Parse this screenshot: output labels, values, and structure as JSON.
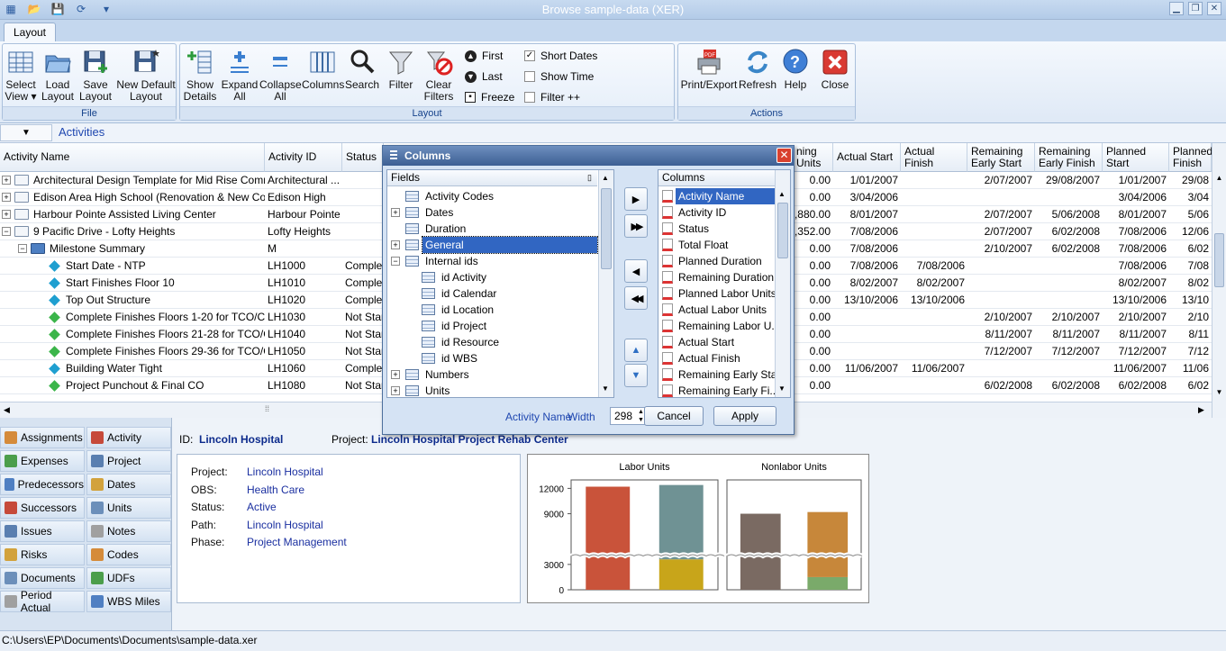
{
  "window": {
    "title": "Browse sample-data (XER)",
    "minimize_label": "▁",
    "restore_label": "❐",
    "close_label": "✕"
  },
  "quick_access": [
    "open-icon",
    "save-icon",
    "refresh-icon",
    "menu-icon"
  ],
  "ribbon": {
    "tab": "Layout",
    "file_group": {
      "label": "File",
      "buttons": [
        {
          "line1": "Select",
          "line2": "View ▾"
        },
        {
          "line1": "Load",
          "line2": "Layout"
        },
        {
          "line1": "Save",
          "line2": "Layout"
        },
        {
          "line1": "New Default",
          "line2": "Layout"
        }
      ]
    },
    "layout_group": {
      "label": "Layout",
      "buttons": [
        {
          "line1": "Show",
          "line2": "Details"
        },
        {
          "line1": "Expand",
          "line2": "All"
        },
        {
          "line1": "Collapse",
          "line2": "All"
        },
        {
          "line1": "Columns",
          "line2": ""
        },
        {
          "line1": "Search",
          "line2": ""
        },
        {
          "line1": "Filter",
          "line2": ""
        },
        {
          "line1": "Clear",
          "line2": "Filters"
        }
      ],
      "nav": {
        "first": "First",
        "last": "Last",
        "freeze": "Freeze"
      },
      "options": {
        "short_dates": "Short Dates",
        "show_time": "Show Time",
        "filter_pp": "Filter ++"
      }
    },
    "actions_group": {
      "label": "Actions",
      "buttons": [
        {
          "line1": "Print/Export",
          "line2": ""
        },
        {
          "line1": "Refresh",
          "line2": ""
        },
        {
          "line1": "Help",
          "line2": ""
        },
        {
          "line1": "Close",
          "line2": ""
        }
      ]
    }
  },
  "view": {
    "name": "Activities"
  },
  "grid": {
    "headers": {
      "activity_name": "Activity Name",
      "activity_id": "Activity ID",
      "status": "Status",
      "nlabor": "ning\nUnits",
      "actual_start": "Actual Start",
      "actual_finish": "Actual Finish",
      "rem_early_start": "Remaining\nEarly Start",
      "rem_early_finish": "Remaining\nEarly Finish",
      "planned_start": "Planned Start",
      "planned_finish": "Planned\nFinish"
    },
    "rows": [
      {
        "name": "Architectural Design Template for Mid Rise Comme...",
        "id": "Architectural ...",
        "status": "",
        "units": "0.00",
        "as": "1/01/2007",
        "af": "",
        "res": "2/07/2007",
        "ref": "29/08/2007",
        "ps": "1/01/2007",
        "pf": "29/08"
      },
      {
        "name": "Edison Area High School (Renovation & New Cons...",
        "id": "Edison High",
        "status": "",
        "units": "0.00",
        "as": "3/04/2006",
        "af": "",
        "res": "",
        "ref": "",
        "ps": "3/04/2006",
        "pf": "3/04"
      },
      {
        "name": "Harbour Pointe Assisted Living Center",
        "id": "Harbour Pointe",
        "status": "",
        "units": "1,880.00",
        "as": "8/01/2007",
        "af": "",
        "res": "2/07/2007",
        "ref": "5/06/2008",
        "ps": "8/01/2007",
        "pf": "5/06"
      },
      {
        "name": "9 Pacific Drive - Lofty Heights",
        "id": "Lofty Heights",
        "status": "",
        "units": "1,352.00",
        "as": "7/08/2006",
        "af": "",
        "res": "2/07/2007",
        "ref": "6/02/2008",
        "ps": "7/08/2006",
        "pf": "12/06"
      },
      {
        "name": "Milestone Summary",
        "id": "M",
        "status": "",
        "units": "0.00",
        "as": "7/08/2006",
        "af": "",
        "res": "2/10/2007",
        "ref": "6/02/2008",
        "ps": "7/08/2006",
        "pf": "6/02"
      },
      {
        "name": "Start Date - NTP",
        "id": "LH1000",
        "status": "Complet",
        "units": "0.00",
        "as": "7/08/2006",
        "af": "7/08/2006",
        "res": "",
        "ref": "",
        "ps": "7/08/2006",
        "pf": "7/08"
      },
      {
        "name": "Start Finishes Floor 10",
        "id": "LH1010",
        "status": "Complet",
        "units": "0.00",
        "as": "8/02/2007",
        "af": "8/02/2007",
        "res": "",
        "ref": "",
        "ps": "8/02/2007",
        "pf": "8/02"
      },
      {
        "name": "Top Out Structure",
        "id": "LH1020",
        "status": "Complet",
        "units": "0.00",
        "as": "13/10/2006",
        "af": "13/10/2006",
        "res": "",
        "ref": "",
        "ps": "13/10/2006",
        "pf": "13/10"
      },
      {
        "name": "Complete Finishes Floors 1-20 for TCO/Clo...",
        "id": "LH1030",
        "status": "Not Star",
        "units": "0.00",
        "as": "",
        "af": "",
        "res": "2/10/2007",
        "ref": "2/10/2007",
        "ps": "2/10/2007",
        "pf": "2/10"
      },
      {
        "name": "Complete Finishes Floors 21-28 for TCO/Cl...",
        "id": "LH1040",
        "status": "Not Star",
        "units": "0.00",
        "as": "",
        "af": "",
        "res": "8/11/2007",
        "ref": "8/11/2007",
        "ps": "8/11/2007",
        "pf": "8/11"
      },
      {
        "name": "Complete Finishes Floors 29-36 for TCO/Cl...",
        "id": "LH1050",
        "status": "Not Star",
        "units": "0.00",
        "as": "",
        "af": "",
        "res": "7/12/2007",
        "ref": "7/12/2007",
        "ps": "7/12/2007",
        "pf": "7/12"
      },
      {
        "name": "Building Water Tight",
        "id": "LH1060",
        "status": "Complet",
        "units": "0.00",
        "as": "11/06/2007",
        "af": "11/06/2007",
        "res": "",
        "ref": "",
        "ps": "11/06/2007",
        "pf": "11/06"
      },
      {
        "name": "Project Punchout & Final CO",
        "id": "LH1080",
        "status": "Not Star",
        "units": "0.00",
        "as": "",
        "af": "",
        "res": "6/02/2008",
        "ref": "6/02/2008",
        "ps": "6/02/2008",
        "pf": "6/02"
      }
    ]
  },
  "dialog": {
    "title": "Columns",
    "fields_header": "Fields",
    "columns_header": "Columns",
    "fields": [
      {
        "label": "Activity Codes",
        "level": 0,
        "expander": ""
      },
      {
        "label": "Dates",
        "level": 0,
        "expander": "+"
      },
      {
        "label": "Duration",
        "level": 0,
        "expander": ""
      },
      {
        "label": "General",
        "level": 0,
        "expander": "+",
        "selected": true
      },
      {
        "label": "Internal ids",
        "level": 0,
        "expander": "−"
      },
      {
        "label": "id Activity",
        "level": 1,
        "expander": ""
      },
      {
        "label": "id Calendar",
        "level": 1,
        "expander": ""
      },
      {
        "label": "id Location",
        "level": 1,
        "expander": ""
      },
      {
        "label": "id Project",
        "level": 1,
        "expander": ""
      },
      {
        "label": "id Resource",
        "level": 1,
        "expander": ""
      },
      {
        "label": "id WBS",
        "level": 1,
        "expander": ""
      },
      {
        "label": "Numbers",
        "level": 0,
        "expander": "+"
      },
      {
        "label": "Units",
        "level": 0,
        "expander": "+"
      }
    ],
    "columns": [
      "Activity Name",
      "Activity ID",
      "Status",
      "Total Float",
      "Planned Duration",
      "Remaining Duration",
      "Planned Labor Units",
      "Actual Labor Units",
      "Remaining Labor U...",
      "Actual Start",
      "Actual Finish",
      "Remaining Early Start",
      "Remaining Early Fi..."
    ],
    "footer": {
      "column_name": "Activity Name",
      "width_label": "Width",
      "width_value": "298",
      "cancel": "Cancel",
      "apply": "Apply"
    }
  },
  "side_nav": [
    {
      "left": "Assignments",
      "right": "Activity"
    },
    {
      "left": "Expenses",
      "right": "Project"
    },
    {
      "left": "Predecessors",
      "right": "Dates"
    },
    {
      "left": "Successors",
      "right": "Units"
    },
    {
      "left": "Issues",
      "right": "Notes"
    },
    {
      "left": "Risks",
      "right": "Codes"
    },
    {
      "left": "Documents",
      "right": "UDFs"
    },
    {
      "left": "Period Actual",
      "right": "WBS Miles"
    }
  ],
  "detail": {
    "id_label": "ID:",
    "id_value": "Lincoln Hospital",
    "project_label": "Project:",
    "project_value": "Lincoln Hospital Project Rehab Center",
    "fields": [
      {
        "label": "Project:",
        "value": "Lincoln Hospital"
      },
      {
        "label": "OBS:",
        "value": "Health Care"
      },
      {
        "label": "Status:",
        "value": "Active"
      },
      {
        "label": "Path:",
        "value": "Lincoln Hospital"
      },
      {
        "label": "Phase:",
        "value": "Project Management"
      }
    ]
  },
  "chart_data": [
    {
      "type": "bar",
      "title": "Labor Units",
      "ylim": [
        0,
        13000
      ],
      "yticks": [
        0,
        3000,
        9000,
        12000
      ],
      "series": [
        {
          "name": "",
          "color": "#c9533a",
          "stack": [
            {
              "value": 12200,
              "color": "#c9533a"
            }
          ]
        },
        {
          "name": "",
          "color": "#6f9294",
          "stack": [
            {
              "value": 3600,
              "color": "#c8a51a"
            },
            {
              "value": 8800,
              "color": "#6f9294"
            }
          ]
        }
      ]
    },
    {
      "type": "bar",
      "title": "Nonlabor Units",
      "ylim": [
        0,
        13000
      ],
      "series": [
        {
          "name": "",
          "color": "#7a6a62",
          "stack": [
            {
              "value": 9000,
              "color": "#7a6a62"
            }
          ]
        },
        {
          "name": "",
          "color": "#c7873a",
          "stack": [
            {
              "value": 1500,
              "color": "#7aaa6a"
            },
            {
              "value": 7700,
              "color": "#c7873a"
            }
          ]
        }
      ]
    }
  ],
  "status_bar": {
    "path": "C:\\Users\\EP\\Documents\\Documents\\sample-data.xer"
  }
}
